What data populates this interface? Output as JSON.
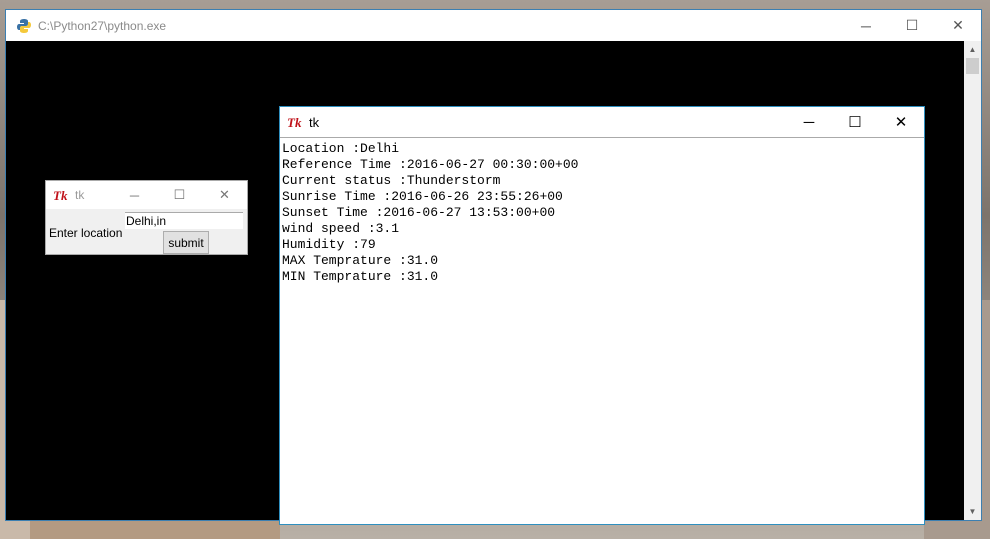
{
  "console": {
    "title": "C:\\Python27\\python.exe"
  },
  "small_tk": {
    "title": "tk",
    "entry_value": "Delhi,in",
    "label": "Enter location",
    "submit_label": "submit"
  },
  "big_tk": {
    "title": "tk",
    "lines": [
      "Location :Delhi",
      "Reference Time :2016-06-27 00:30:00+00",
      "Current status :Thunderstorm",
      "Sunrise Time :2016-06-26 23:55:26+00",
      "Sunset Time :2016-06-27 13:53:00+00",
      "wind speed :3.1",
      "Humidity :79",
      "MAX Temprature :31.0",
      "MIN Temprature :31.0"
    ]
  },
  "icons": {
    "minimize": "─",
    "maximize": "☐",
    "close": "✕",
    "scroll_up": "▲",
    "scroll_down": "▼"
  }
}
